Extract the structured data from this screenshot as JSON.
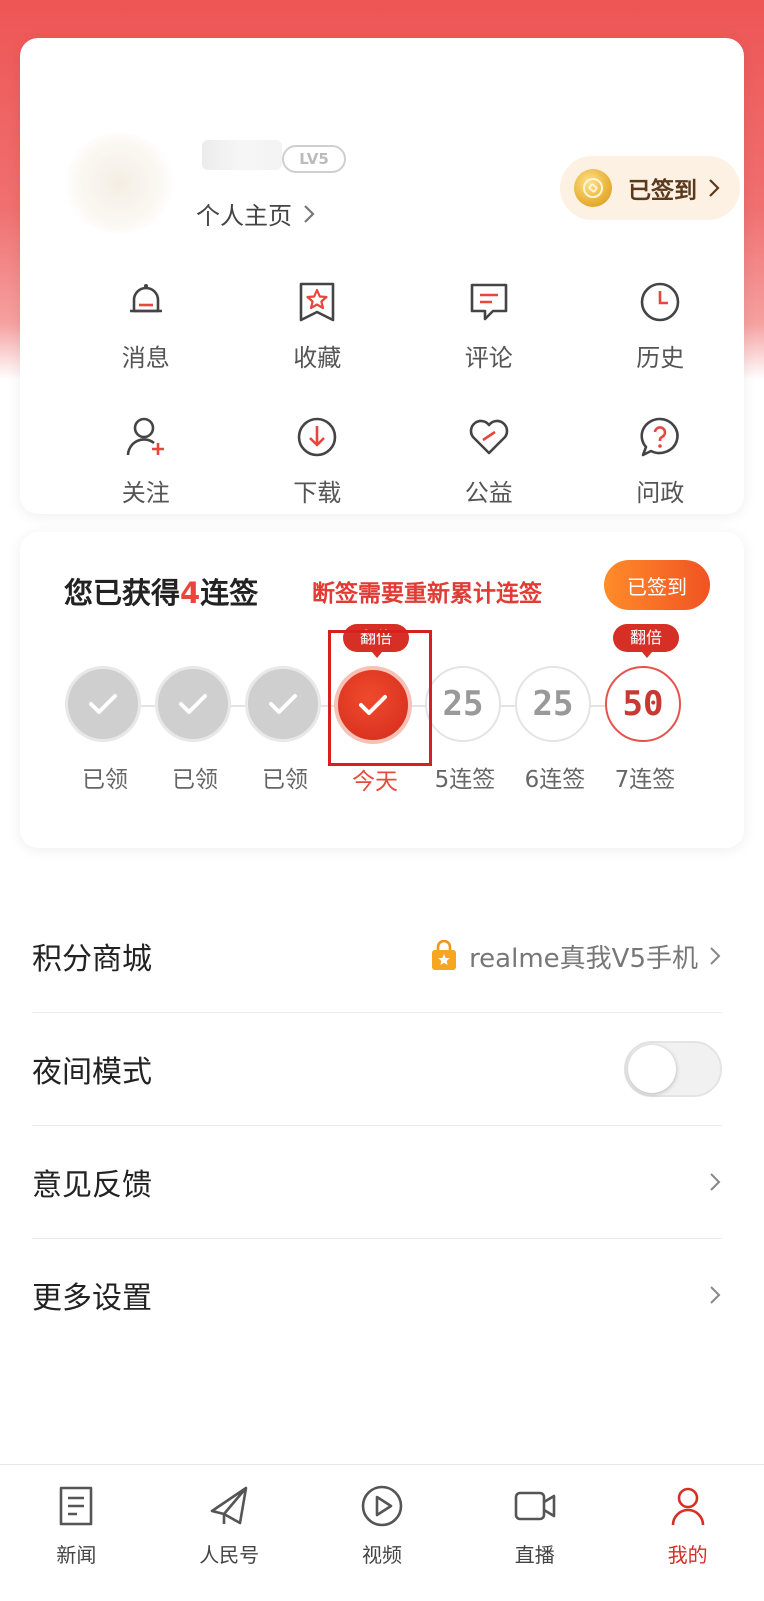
{
  "profile": {
    "level_badge": "LV5",
    "homepage_link": "个人主页",
    "sign_status": "已签到"
  },
  "quick_links": [
    {
      "label": "消息",
      "icon": "bell-icon"
    },
    {
      "label": "收藏",
      "icon": "bookmark-star-icon"
    },
    {
      "label": "评论",
      "icon": "comment-icon"
    },
    {
      "label": "历史",
      "icon": "clock-icon"
    },
    {
      "label": "关注",
      "icon": "user-plus-icon"
    },
    {
      "label": "下载",
      "icon": "download-icon"
    },
    {
      "label": "公益",
      "icon": "charity-heart-icon"
    },
    {
      "label": "问政",
      "icon": "question-bubble-icon"
    }
  ],
  "checkin": {
    "title_prefix": "您已获得",
    "streak_count": "4",
    "title_suffix": "连签",
    "note": "断签需要重新累计连签",
    "button": "已签到",
    "double_tag": "翻倍",
    "days": [
      {
        "label": "已领",
        "state": "done",
        "points": ""
      },
      {
        "label": "已领",
        "state": "done",
        "points": ""
      },
      {
        "label": "已领",
        "state": "done",
        "points": ""
      },
      {
        "label": "今天",
        "state": "today",
        "points": ""
      },
      {
        "label": "5连签",
        "state": "future",
        "points": "25"
      },
      {
        "label": "6连签",
        "state": "future",
        "points": "25"
      },
      {
        "label": "7连签",
        "state": "bonus",
        "points": "50"
      }
    ]
  },
  "settings": {
    "mall": {
      "title": "积分商城",
      "promo": "realme真我V5手机"
    },
    "night_mode": {
      "title": "夜间模式",
      "enabled": false
    },
    "feedback": {
      "title": "意见反馈"
    },
    "more": {
      "title": "更多设置"
    }
  },
  "tabbar": [
    {
      "label": "新闻",
      "icon": "news-icon"
    },
    {
      "label": "人民号",
      "icon": "send-icon"
    },
    {
      "label": "视频",
      "icon": "play-icon"
    },
    {
      "label": "直播",
      "icon": "camera-icon"
    },
    {
      "label": "我的",
      "icon": "profile-icon",
      "active": true
    }
  ],
  "colors": {
    "accent": "#e8453c",
    "header": "#ee5555"
  }
}
